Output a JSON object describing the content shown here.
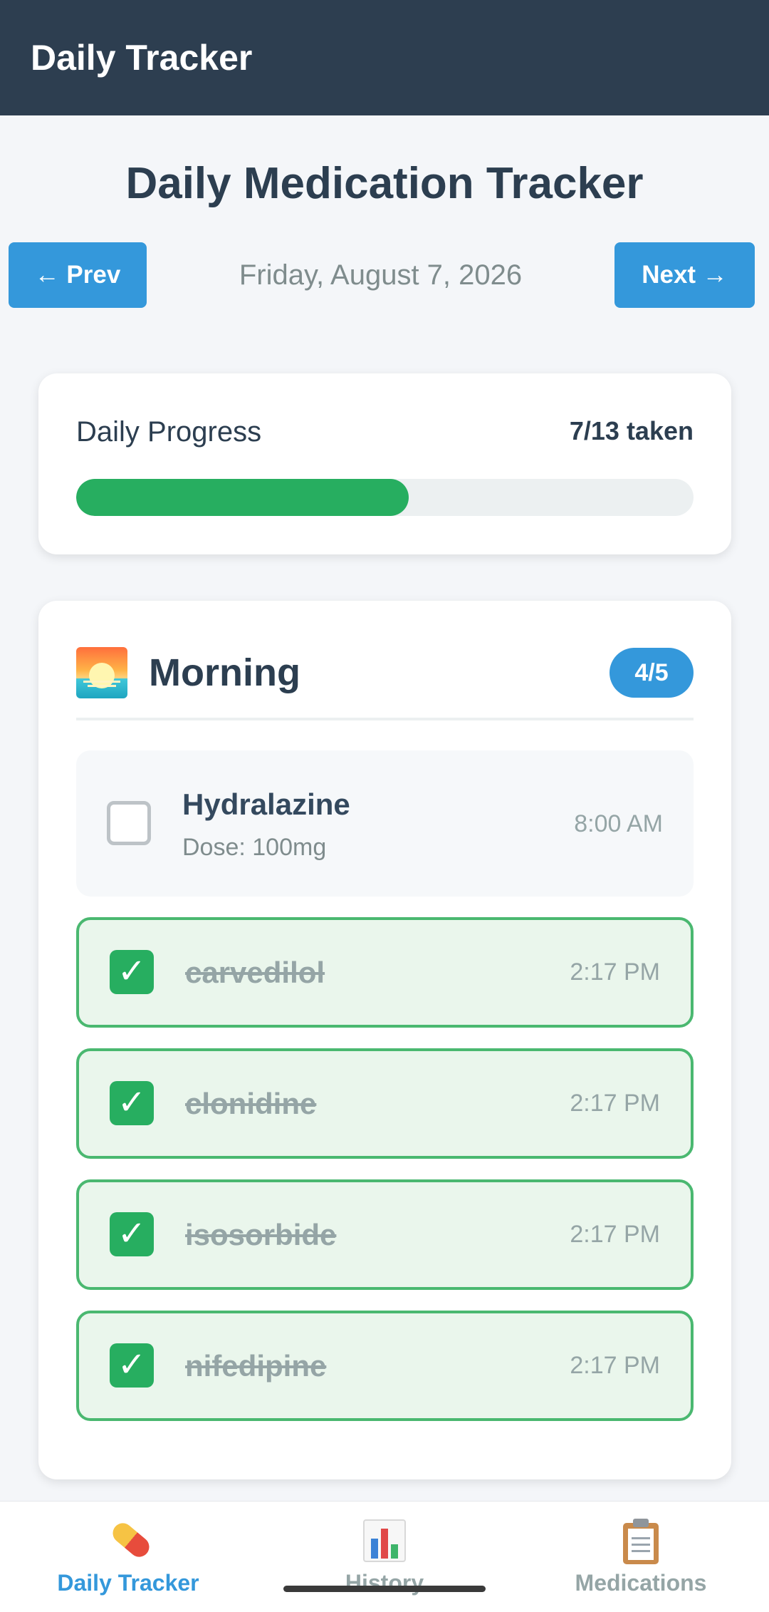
{
  "appbar": {
    "title": "Daily Tracker"
  },
  "page": {
    "title": "Daily Medication Tracker"
  },
  "date_nav": {
    "prev_label": "← Prev",
    "date": "Friday, August 7, 2026",
    "next_label": "Next →"
  },
  "progress": {
    "label": "Daily Progress",
    "count_text": "7/13 taken",
    "taken": 7,
    "total": 13
  },
  "morning": {
    "title": "Morning",
    "badge": "4/5",
    "meds": [
      {
        "name": "Hydralazine",
        "dose": "Dose: 100mg",
        "time": "8:00 AM",
        "taken": false
      },
      {
        "name": "carvedilol",
        "time": "2:17 PM",
        "taken": true
      },
      {
        "name": "clonidine",
        "time": "2:17 PM",
        "taken": true
      },
      {
        "name": "isosorbide",
        "time": "2:17 PM",
        "taken": true
      },
      {
        "name": "nifedipine",
        "time": "2:17 PM",
        "taken": true
      }
    ]
  },
  "bottom_nav": {
    "items": [
      {
        "label": "Daily Tracker",
        "icon": "pill-icon",
        "active": true
      },
      {
        "label": "History",
        "icon": "bar-chart-icon",
        "active": false
      },
      {
        "label": "Medications",
        "icon": "clipboard-icon",
        "active": false
      }
    ]
  },
  "colors": {
    "appbar": "#2d3e50",
    "accent": "#3498db",
    "success": "#27ae60",
    "taken_bg": "#eaf6ec"
  }
}
